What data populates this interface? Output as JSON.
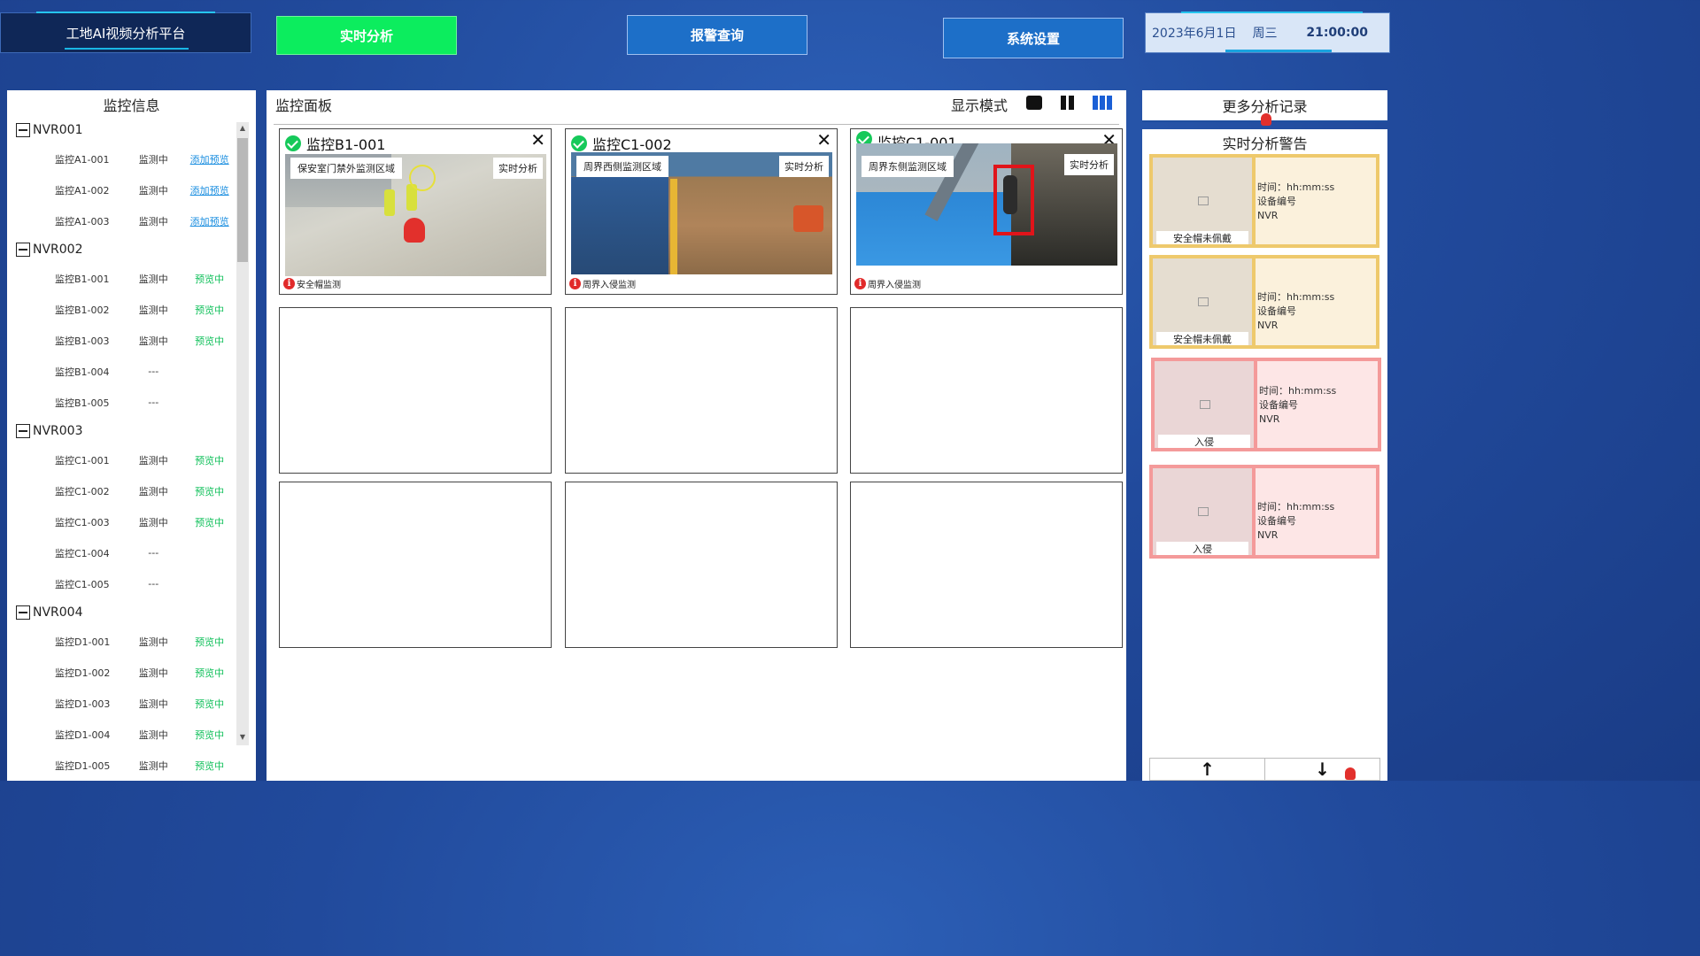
{
  "header": {
    "brand": "工地AI视频分析平台",
    "nav": [
      "实时分析",
      "报警查询",
      "系统设置"
    ],
    "date": "2023年6月1日",
    "weekday": "周三",
    "time": "21:00:00"
  },
  "left": {
    "title": "监控信息",
    "groups": [
      {
        "name": "NVR001",
        "cams": [
          {
            "name": "监控A1-001",
            "status": "监测中",
            "action": "添加预览",
            "type": "add"
          },
          {
            "name": "监控A1-002",
            "status": "监测中",
            "action": "添加预览",
            "type": "add"
          },
          {
            "name": "监控A1-003",
            "status": "监测中",
            "action": "添加预览",
            "type": "add"
          }
        ]
      },
      {
        "name": "NVR002",
        "cams": [
          {
            "name": "监控B1-001",
            "status": "监测中",
            "action": "预览中",
            "type": "preview"
          },
          {
            "name": "监控B1-002",
            "status": "监测中",
            "action": "预览中",
            "type": "preview"
          },
          {
            "name": "监控B1-003",
            "status": "监测中",
            "action": "预览中",
            "type": "preview"
          },
          {
            "name": "监控B1-004",
            "status": "---",
            "action": "",
            "type": "none"
          },
          {
            "name": "监控B1-005",
            "status": "---",
            "action": "",
            "type": "none"
          }
        ]
      },
      {
        "name": "NVR003",
        "cams": [
          {
            "name": "监控C1-001",
            "status": "监测中",
            "action": "预览中",
            "type": "preview"
          },
          {
            "name": "监控C1-002",
            "status": "监测中",
            "action": "预览中",
            "type": "preview"
          },
          {
            "name": "监控C1-003",
            "status": "监测中",
            "action": "预览中",
            "type": "preview"
          },
          {
            "name": "监控C1-004",
            "status": "---",
            "action": "",
            "type": "none"
          },
          {
            "name": "监控C1-005",
            "status": "---",
            "action": "",
            "type": "none"
          }
        ]
      },
      {
        "name": "NVR004",
        "cams": [
          {
            "name": "监控D1-001",
            "status": "监测中",
            "action": "预览中",
            "type": "preview"
          },
          {
            "name": "监控D1-002",
            "status": "监测中",
            "action": "预览中",
            "type": "preview"
          },
          {
            "name": "监控D1-003",
            "status": "监测中",
            "action": "预览中",
            "type": "preview"
          },
          {
            "name": "监控D1-004",
            "status": "监测中",
            "action": "预览中",
            "type": "preview"
          },
          {
            "name": "监控D1-005",
            "status": "监测中",
            "action": "预览中",
            "type": "preview"
          }
        ]
      }
    ]
  },
  "center": {
    "title": "监控面板",
    "display_mode_label": "显示模式",
    "cells": [
      {
        "title": "监控B1-001",
        "region": "保安室门禁外监测区域",
        "analysis": "实时分析",
        "footer": "安全帽监测"
      },
      {
        "title": "监控C1-002",
        "region": "周界西侧监测区域",
        "analysis": "实时分析",
        "footer": "周界入侵监测"
      },
      {
        "title": "监控C1-001",
        "region": "周界东侧监测区域",
        "analysis": "实时分析",
        "footer": "周界入侵监测"
      }
    ]
  },
  "right": {
    "more_records": "更多分析记录",
    "title": "实时分析警告",
    "alerts": [
      {
        "label": "安全帽未佩戴",
        "time": "时间：hh:mm:ss",
        "device": "设备编号",
        "nvr": "NVR",
        "level": "yellow"
      },
      {
        "label": "安全帽未佩戴",
        "time": "时间：hh:mm:ss",
        "device": "设备编号",
        "nvr": "NVR",
        "level": "yellow"
      },
      {
        "label": "入侵",
        "time": "时间：hh:mm:ss",
        "device": "设备编号",
        "nvr": "NVR",
        "level": "red"
      },
      {
        "label": "入侵",
        "time": "时间：hh:mm:ss",
        "device": "设备编号",
        "nvr": "NVR",
        "level": "red"
      }
    ],
    "pager_up": "↑",
    "pager_down": "↓"
  },
  "colors": {
    "accent_green": "#0ced5e",
    "nav_blue": "#1d6fc8",
    "alert_yellow": "#eec96c",
    "alert_red": "#f49a9a"
  },
  "icons": {
    "collapse": "minus-square-icon",
    "check": "check-circle-icon",
    "close": "close-icon",
    "info": "info-icon",
    "image": "image-icon"
  }
}
